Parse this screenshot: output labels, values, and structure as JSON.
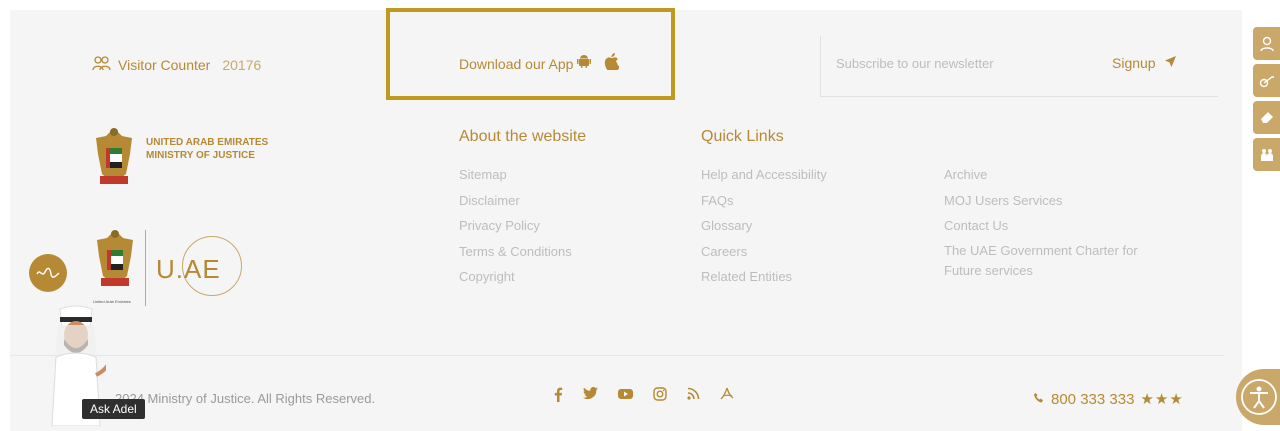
{
  "top": {
    "visitor_label": "Visitor Counter",
    "visitor_count": "20176",
    "app_label": "Download our App",
    "newsletter_placeholder": "Subscribe to our newsletter",
    "signup_label": "Signup"
  },
  "logos": {
    "moj_line1": "UNITED ARAB EMIRATES",
    "moj_line2": "MINISTRY OF JUSTICE",
    "uae_mark": "U.AE",
    "uae_small": "United Arab Emirates"
  },
  "about": {
    "title": "About the website",
    "items": [
      "Sitemap",
      "Disclaimer",
      "Privacy Policy",
      "Terms & Conditions",
      "Copyright"
    ]
  },
  "quick": {
    "title": "Quick Links",
    "items": [
      "Help and Accessibility",
      "FAQs",
      "Glossary",
      "Careers",
      "Related Entities"
    ]
  },
  "extra": {
    "items": [
      "Archive",
      "MOJ Users Services",
      "Contact Us",
      "The UAE Government Charter for Future services"
    ]
  },
  "bottom": {
    "copyright": "2024 Ministry of Justice. All Rights Reserved.",
    "phone": "800 333 333",
    "stars": "★★★",
    "social_icons": [
      "facebook-icon",
      "twitter-icon",
      "youtube-icon",
      "instagram-icon",
      "rss-icon",
      "pdf-icon"
    ]
  },
  "widgets": {
    "ask_adel": "Ask Adel"
  },
  "colors": {
    "gold": "#b68a35",
    "highlight_border": "#c09a1e",
    "background": "#f5f5f5"
  }
}
